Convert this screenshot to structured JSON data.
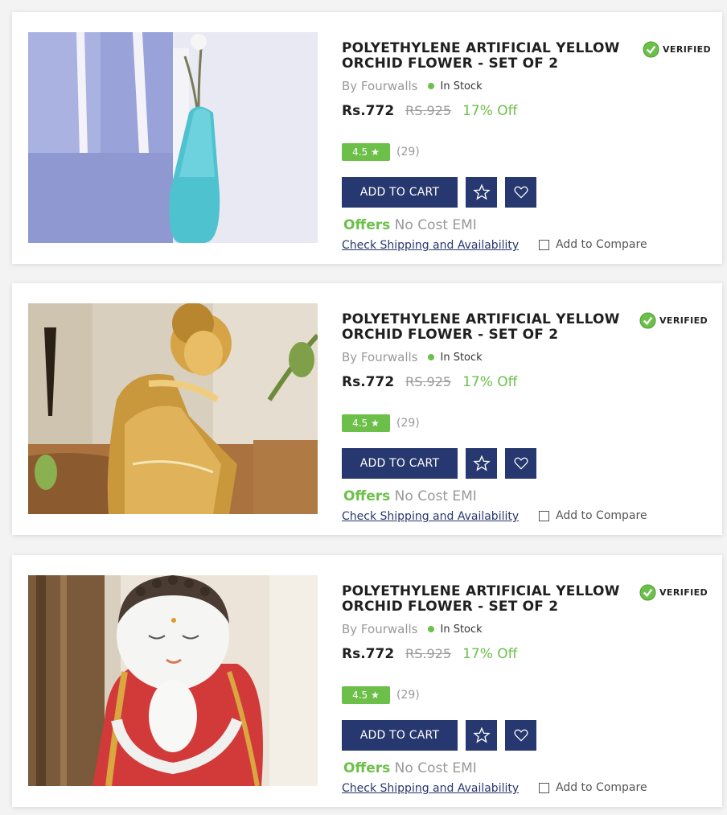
{
  "theme": {
    "accent": "#27376f",
    "green": "#6cc04a"
  },
  "products": [
    {
      "image_alt": "blue vase with sheets",
      "title": "POLYETHYLENE ARTIFICIAL YELLOW ORCHID FLOWER - SET OF 2",
      "verified_label": "VERIFIED",
      "brand": "By Fourwalls",
      "stock": "In Stock",
      "price": "Rs.772",
      "mrp": "RS.925",
      "discount": "17% Off",
      "rating": "4.5",
      "rating_count": "(29)",
      "add_to_cart": "ADD TO CART",
      "offers_label": "Offers",
      "offers_text": "No Cost EMI",
      "shipping_link": "Check Shipping and Availability",
      "compare_label": "Add to Compare"
    },
    {
      "image_alt": "golden sleeping buddha figurine",
      "title": "POLYETHYLENE ARTIFICIAL YELLOW ORCHID FLOWER - SET OF 2",
      "verified_label": "VERIFIED",
      "brand": "By Fourwalls",
      "stock": "In Stock",
      "price": "Rs.772",
      "mrp": "RS.925",
      "discount": "17% Off",
      "rating": "4.5",
      "rating_count": "(29)",
      "add_to_cart": "ADD TO CART",
      "offers_label": "Offers",
      "offers_text": "No Cost EMI",
      "shipping_link": "Check Shipping and Availability",
      "compare_label": "Add to Compare"
    },
    {
      "image_alt": "white and red buddha monk figurine",
      "title": "POLYETHYLENE ARTIFICIAL YELLOW ORCHID FLOWER - SET OF 2",
      "verified_label": "VERIFIED",
      "brand": "By Fourwalls",
      "stock": "In Stock",
      "price": "Rs.772",
      "mrp": "RS.925",
      "discount": "17% Off",
      "rating": "4.5",
      "rating_count": "(29)",
      "add_to_cart": "ADD TO CART",
      "offers_label": "Offers",
      "offers_text": "No Cost EMI",
      "shipping_link": "Check Shipping and Availability",
      "compare_label": "Add to Compare"
    }
  ]
}
